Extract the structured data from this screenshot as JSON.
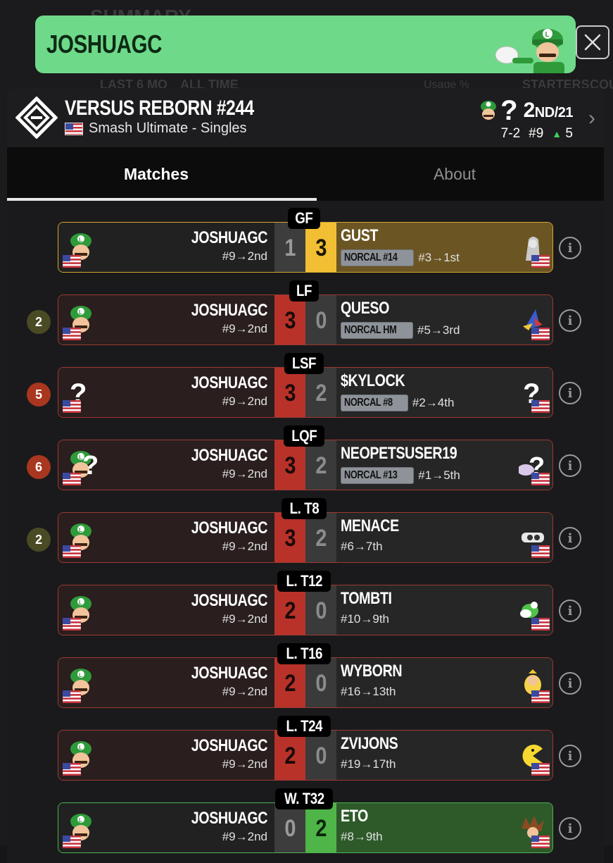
{
  "background": {
    "summary_heading": "SUMMARY",
    "filters": [
      "LAST 6 MO",
      "ALL TIME"
    ],
    "usage_label": "Usage %",
    "starters_label": "STARTERS",
    "col_label": "COU"
  },
  "banner": {
    "player_name": "JOSHUAGC",
    "chevron": "›",
    "close_label": "×",
    "color": "#6fd98a"
  },
  "event": {
    "title": "VERSUS REBORN #244",
    "game": "Smash Ultimate - Singles",
    "placement": "2",
    "placement_suffix": "ND",
    "placement_total": "/21",
    "record": "7-2",
    "seed": "#9",
    "seed_delta": "5"
  },
  "tabs": {
    "matches": "Matches",
    "about": "About",
    "active": "Matches"
  },
  "matches": [
    {
      "round": "GF",
      "badge": "",
      "p1": "JOSHUAGC",
      "p1_sub": "#9→2nd",
      "s1": "1",
      "s2": "3",
      "p2": "GUST",
      "p2_tag": "NORCAL #14",
      "p2_sub": "#3→1st",
      "style": "gold"
    },
    {
      "round": "LF",
      "badge": "2",
      "p1": "JOSHUAGC",
      "p1_sub": "#9→2nd",
      "s1": "3",
      "s2": "0",
      "p2": "QUESO",
      "p2_tag": "NORCAL HM",
      "p2_sub": "#5→3rd",
      "style": "loss"
    },
    {
      "round": "LSF",
      "badge": "5",
      "p1": "JOSHUAGC",
      "p1_sub": "#9→2nd",
      "s1": "3",
      "s2": "2",
      "p2": "$KYLOCK",
      "p2_tag": "NORCAL #8",
      "p2_sub": "#2→4th",
      "style": "loss"
    },
    {
      "round": "LQF",
      "badge": "6",
      "p1": "JOSHUAGC",
      "p1_sub": "#9→2nd",
      "s1": "3",
      "s2": "2",
      "p2": "NEOPETSUSER19",
      "p2_tag": "NORCAL #13",
      "p2_sub": "#1→5th",
      "style": "loss"
    },
    {
      "round": "L. T8",
      "badge": "2",
      "p1": "JOSHUAGC",
      "p1_sub": "#9→2nd",
      "s1": "3",
      "s2": "2",
      "p2": "MENACE",
      "p2_tag": "",
      "p2_sub": "#6→7th",
      "style": "loss"
    },
    {
      "round": "L. T12",
      "badge": "",
      "p1": "JOSHUAGC",
      "p1_sub": "#9→2nd",
      "s1": "2",
      "s2": "0",
      "p2": "TOMBTI",
      "p2_tag": "",
      "p2_sub": "#10→9th",
      "style": "loss"
    },
    {
      "round": "L. T16",
      "badge": "",
      "p1": "JOSHUAGC",
      "p1_sub": "#9→2nd",
      "s1": "2",
      "s2": "0",
      "p2": "WYBORN",
      "p2_tag": "",
      "p2_sub": "#16→13th",
      "style": "loss"
    },
    {
      "round": "L. T24",
      "badge": "",
      "p1": "JOSHUAGC",
      "p1_sub": "#9→2nd",
      "s1": "2",
      "s2": "0",
      "p2": "ZVIJONS",
      "p2_tag": "",
      "p2_sub": "#19→17th",
      "style": "loss"
    },
    {
      "round": "W. T32",
      "badge": "",
      "p1": "JOSHUAGC",
      "p1_sub": "#9→2nd",
      "s1": "0",
      "s2": "2",
      "p2": "ETO",
      "p2_tag": "",
      "p2_sub": "#8→9th",
      "style": "win"
    }
  ],
  "colors": {
    "badge_olive": "#4a4a25",
    "badge_red": "#a9361f",
    "loss_red": "#b8322a",
    "gold": "#f2bf34",
    "win_green": "#4fb548"
  }
}
